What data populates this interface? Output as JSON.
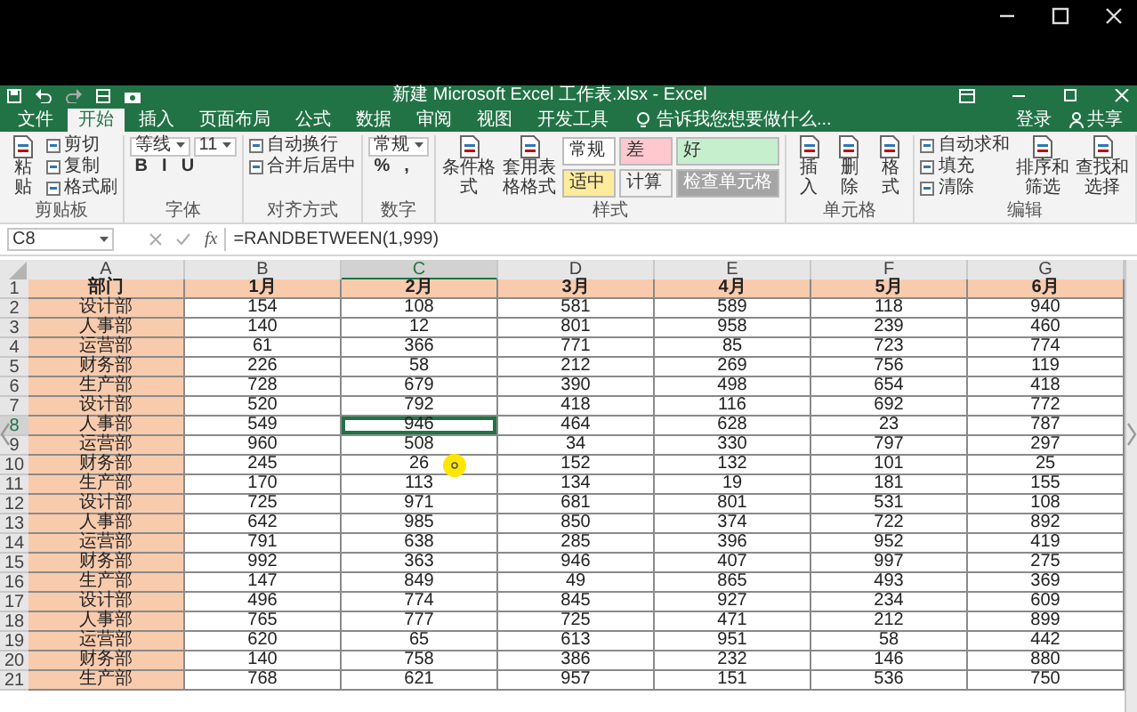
{
  "window": {
    "title": "新建 Microsoft Excel 工作表.xlsx - Excel"
  },
  "tabs": [
    {
      "label": "文件",
      "selected": false
    },
    {
      "label": "开始",
      "selected": true
    },
    {
      "label": "插入",
      "selected": false
    },
    {
      "label": "页面布局",
      "selected": false
    },
    {
      "label": "公式",
      "selected": false
    },
    {
      "label": "数据",
      "selected": false
    },
    {
      "label": "审阅",
      "selected": false
    },
    {
      "label": "视图",
      "selected": false
    },
    {
      "label": "开发工具",
      "selected": false
    }
  ],
  "tell_me": "告诉我您想要做什么...",
  "account": {
    "sign_in": "登录",
    "share": "共享"
  },
  "ribbon": [
    {
      "label": "剪贴板",
      "columns": [
        {
          "kind": "large",
          "label": "粘贴"
        },
        {
          "kind": "stack",
          "lines": [
            {
              "items": [
                {
                  "kind": "tool",
                  "label": "剪切"
                }
              ]
            },
            {
              "items": [
                {
                  "kind": "tool",
                  "label": "复制"
                }
              ]
            },
            {
              "items": [
                {
                  "kind": "tool",
                  "label": "格式刷"
                }
              ]
            }
          ]
        }
      ]
    },
    {
      "label": "字体",
      "columns": [
        {
          "kind": "stack",
          "lines": [
            {
              "items": [
                {
                  "kind": "field",
                  "label": "等线"
                },
                {
                  "kind": "field",
                  "label": "11"
                }
              ]
            },
            {
              "items": [
                {
                  "kind": "text",
                  "label": "B"
                },
                {
                  "kind": "text",
                  "label": "I"
                },
                {
                  "kind": "text",
                  "label": "U"
                }
              ]
            }
          ]
        }
      ]
    },
    {
      "label": "对齐方式",
      "columns": [
        {
          "kind": "stack",
          "lines": [
            {
              "items": [
                {
                  "kind": "tool",
                  "label": "自动换行"
                }
              ]
            },
            {
              "items": [
                {
                  "kind": "tool",
                  "label": "合并后居中"
                }
              ]
            }
          ]
        }
      ]
    },
    {
      "label": "数字",
      "columns": [
        {
          "kind": "stack",
          "lines": [
            {
              "items": [
                {
                  "kind": "field",
                  "label": "常规"
                }
              ]
            },
            {
              "items": [
                {
                  "kind": "text",
                  "label": "%"
                },
                {
                  "kind": "text",
                  "label": ","
                }
              ]
            }
          ]
        }
      ]
    },
    {
      "label": "样式",
      "columns": [
        {
          "kind": "large",
          "label": "条件格式"
        },
        {
          "kind": "large",
          "label": "套用表格格式"
        },
        {
          "kind": "styles",
          "cells": [
            {
              "label": "常规",
              "color": "#ffffff"
            },
            {
              "label": "适中",
              "color": "#ffeb9c"
            },
            {
              "label": "差",
              "color": "#ffc7ce"
            },
            {
              "label": "计算",
              "color": "#f2f2f2"
            },
            {
              "label": "好",
              "color": "#c6efce"
            },
            {
              "label": "检查单元格",
              "color": "#a5a5a5"
            }
          ]
        }
      ]
    },
    {
      "label": "单元格",
      "columns": [
        {
          "kind": "large",
          "label": "插入"
        },
        {
          "kind": "large",
          "label": "删除"
        },
        {
          "kind": "large",
          "label": "格式"
        }
      ]
    },
    {
      "label": "编辑",
      "columns": [
        {
          "kind": "stack",
          "lines": [
            {
              "items": [
                {
                  "kind": "tool",
                  "label": "自动求和"
                }
              ]
            },
            {
              "items": [
                {
                  "kind": "tool",
                  "label": "填充"
                }
              ]
            },
            {
              "items": [
                {
                  "kind": "tool",
                  "label": "清除"
                }
              ]
            }
          ]
        },
        {
          "kind": "large",
          "label": "排序和筛选"
        },
        {
          "kind": "large",
          "label": "查找和选择"
        }
      ]
    }
  ],
  "formula_bar": {
    "name_box": "C8",
    "fx": "fx",
    "formula": "=RANDBETWEEN(1,999)"
  },
  "sheet": {
    "columns": [
      {
        "label": "A",
        "kind": "label",
        "selected": false
      },
      {
        "label": "B",
        "kind": "value",
        "selected": false
      },
      {
        "label": "C",
        "kind": "value",
        "selected": true
      },
      {
        "label": "D",
        "kind": "value",
        "selected": false
      },
      {
        "label": "E",
        "kind": "value",
        "selected": false
      },
      {
        "label": "F",
        "kind": "value",
        "selected": false
      },
      {
        "label": "G",
        "kind": "value",
        "selected": false
      }
    ],
    "rows": [
      {
        "number": "1",
        "kind": "header",
        "selected": false,
        "cells": [
          "部门",
          "1月",
          "2月",
          "3月",
          "4月",
          "5月",
          "6月"
        ]
      },
      {
        "number": "2",
        "kind": "data",
        "selected": false,
        "cells": [
          "设计部",
          "154",
          "108",
          "581",
          "589",
          "118",
          "940"
        ]
      },
      {
        "number": "3",
        "kind": "data",
        "selected": false,
        "cells": [
          "人事部",
          "140",
          "12",
          "801",
          "958",
          "239",
          "460"
        ]
      },
      {
        "number": "4",
        "kind": "data",
        "selected": false,
        "cells": [
          "运营部",
          "61",
          "366",
          "771",
          "85",
          "723",
          "774"
        ]
      },
      {
        "number": "5",
        "kind": "data",
        "selected": false,
        "cells": [
          "财务部",
          "226",
          "58",
          "212",
          "269",
          "756",
          "119"
        ]
      },
      {
        "number": "6",
        "kind": "data",
        "selected": false,
        "cells": [
          "生产部",
          "728",
          "679",
          "390",
          "498",
          "654",
          "418"
        ]
      },
      {
        "number": "7",
        "kind": "data",
        "selected": false,
        "cells": [
          "设计部",
          "520",
          "792",
          "418",
          "116",
          "692",
          "772"
        ]
      },
      {
        "number": "8",
        "kind": "data",
        "selected": true,
        "cells": [
          "人事部",
          "549",
          "946",
          "464",
          "628",
          "23",
          "787"
        ]
      },
      {
        "number": "9",
        "kind": "data",
        "selected": false,
        "cells": [
          "运营部",
          "960",
          "508",
          "34",
          "330",
          "797",
          "297"
        ]
      },
      {
        "number": "10",
        "kind": "data",
        "selected": false,
        "cells": [
          "财务部",
          "245",
          "26",
          "152",
          "132",
          "101",
          "25"
        ]
      },
      {
        "number": "11",
        "kind": "data",
        "selected": false,
        "cells": [
          "生产部",
          "170",
          "113",
          "134",
          "19",
          "181",
          "155"
        ]
      },
      {
        "number": "12",
        "kind": "data",
        "selected": false,
        "cells": [
          "设计部",
          "725",
          "971",
          "681",
          "801",
          "531",
          "108"
        ]
      },
      {
        "number": "13",
        "kind": "data",
        "selected": false,
        "cells": [
          "人事部",
          "642",
          "985",
          "850",
          "374",
          "722",
          "892"
        ]
      },
      {
        "number": "14",
        "kind": "data",
        "selected": false,
        "cells": [
          "运营部",
          "791",
          "638",
          "285",
          "396",
          "952",
          "419"
        ]
      },
      {
        "number": "15",
        "kind": "data",
        "selected": false,
        "cells": [
          "财务部",
          "992",
          "363",
          "946",
          "407",
          "997",
          "275"
        ]
      },
      {
        "number": "16",
        "kind": "data",
        "selected": false,
        "cells": [
          "生产部",
          "147",
          "849",
          "49",
          "865",
          "493",
          "369"
        ]
      },
      {
        "number": "17",
        "kind": "data",
        "selected": false,
        "cells": [
          "设计部",
          "496",
          "774",
          "845",
          "927",
          "234",
          "609"
        ]
      },
      {
        "number": "18",
        "kind": "data",
        "selected": false,
        "cells": [
          "人事部",
          "765",
          "777",
          "725",
          "471",
          "212",
          "899"
        ]
      },
      {
        "number": "19",
        "kind": "data",
        "selected": false,
        "cells": [
          "运营部",
          "620",
          "65",
          "613",
          "951",
          "58",
          "442"
        ]
      },
      {
        "number": "20",
        "kind": "data",
        "selected": false,
        "cells": [
          "财务部",
          "140",
          "758",
          "386",
          "232",
          "146",
          "880"
        ]
      },
      {
        "number": "21",
        "kind": "data",
        "selected": false,
        "cells": [
          "生产部",
          "768",
          "621",
          "957",
          "151",
          "536",
          "750"
        ]
      }
    ]
  }
}
